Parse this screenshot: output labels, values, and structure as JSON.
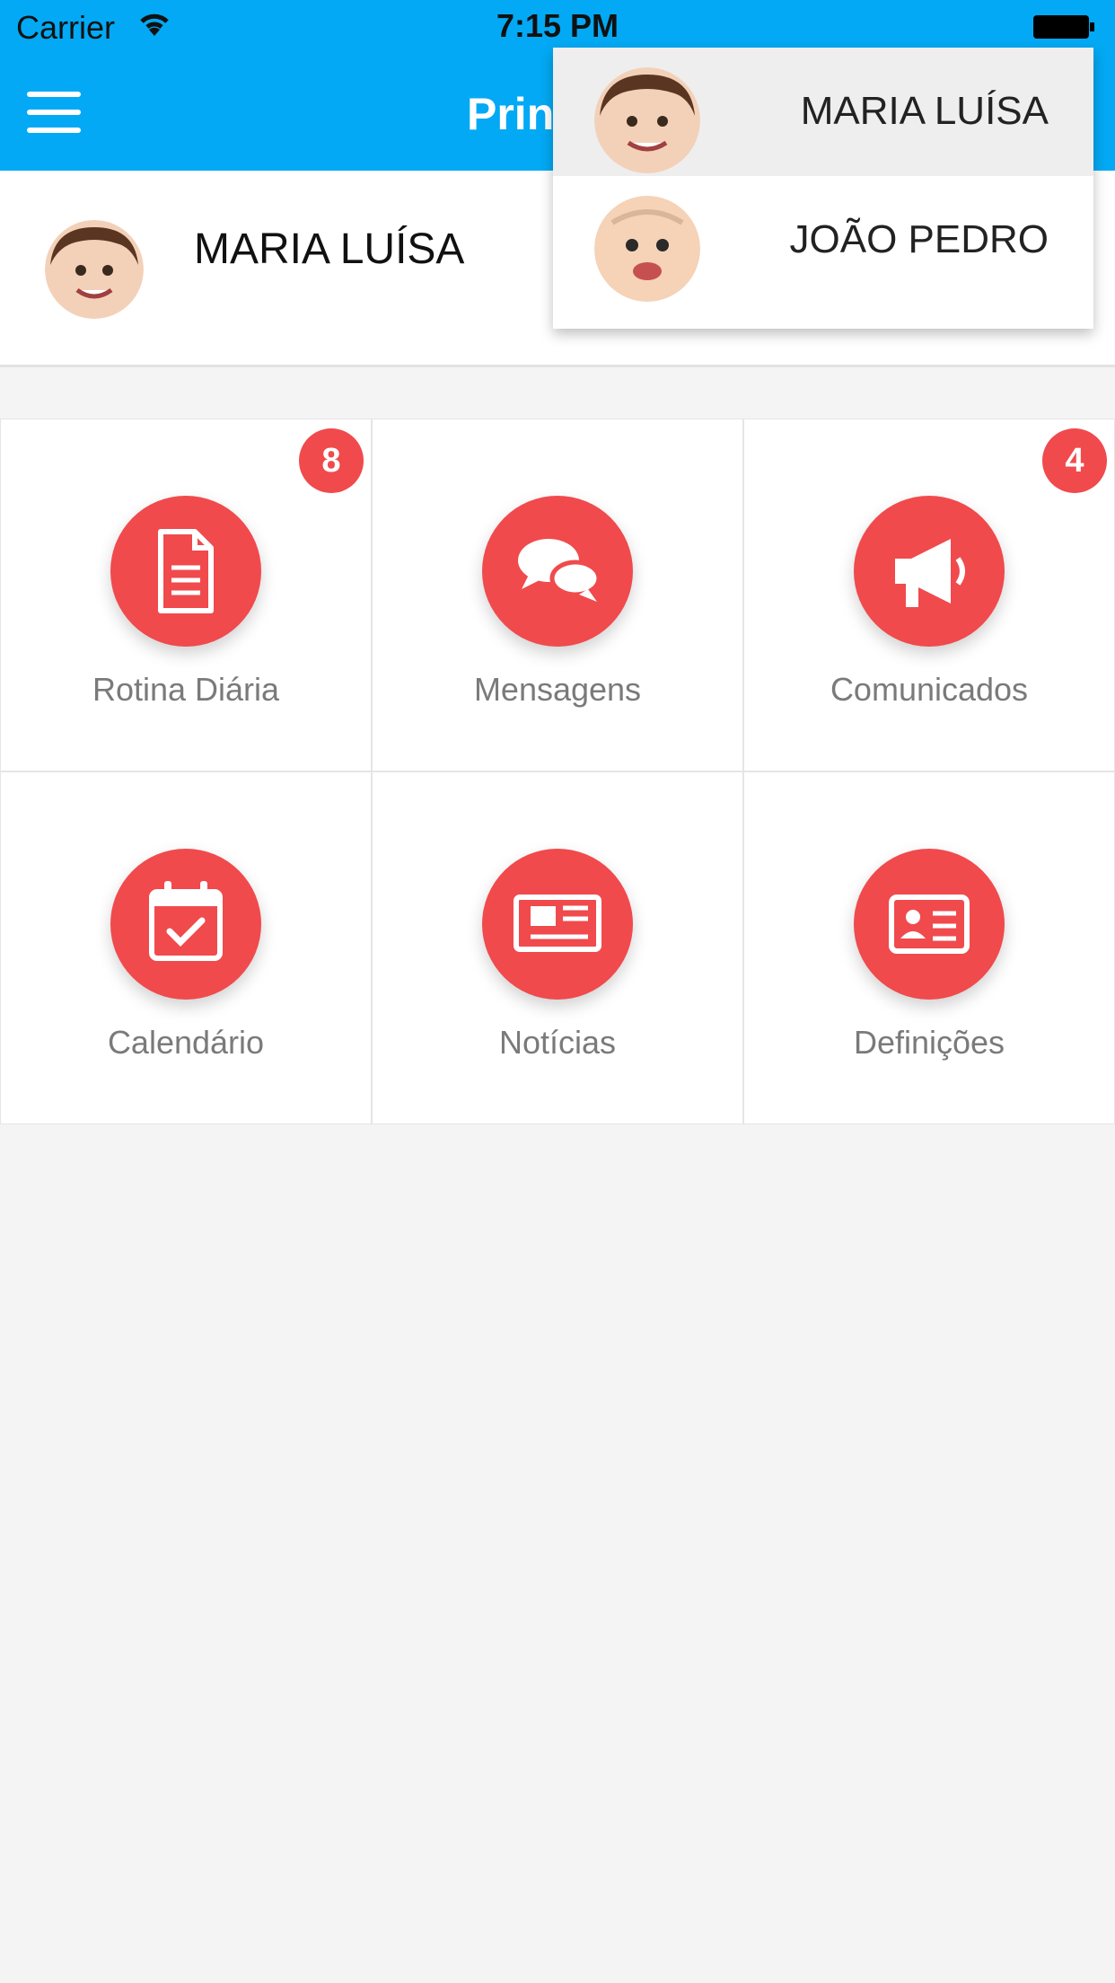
{
  "status_bar": {
    "carrier": "Carrier",
    "time": "7:15 PM"
  },
  "header": {
    "title": "Princ",
    "menu_icon": "hamburger-menu-icon"
  },
  "selected_child": {
    "name": "MARIA LUÍSA"
  },
  "grid": [
    {
      "label": "Rotina Diária",
      "icon": "document-icon",
      "badge": "8"
    },
    {
      "label": "Mensagens",
      "icon": "chat-bubbles-icon",
      "badge": ""
    },
    {
      "label": "Comunicados",
      "icon": "megaphone-icon",
      "badge": "4"
    },
    {
      "label": "Calendário",
      "icon": "calendar-check-icon",
      "badge": ""
    },
    {
      "label": "Notícias",
      "icon": "newspaper-icon",
      "badge": ""
    },
    {
      "label": "Definições",
      "icon": "id-card-icon",
      "badge": ""
    }
  ],
  "dropdown": {
    "items": [
      {
        "name": "MARIA LUÍSA",
        "selected": true
      },
      {
        "name": "JOÃO PEDRO",
        "selected": false
      }
    ]
  },
  "colors": {
    "header": "#03a9f4",
    "accent": "#f04a4d",
    "label": "#7a7a7a"
  }
}
